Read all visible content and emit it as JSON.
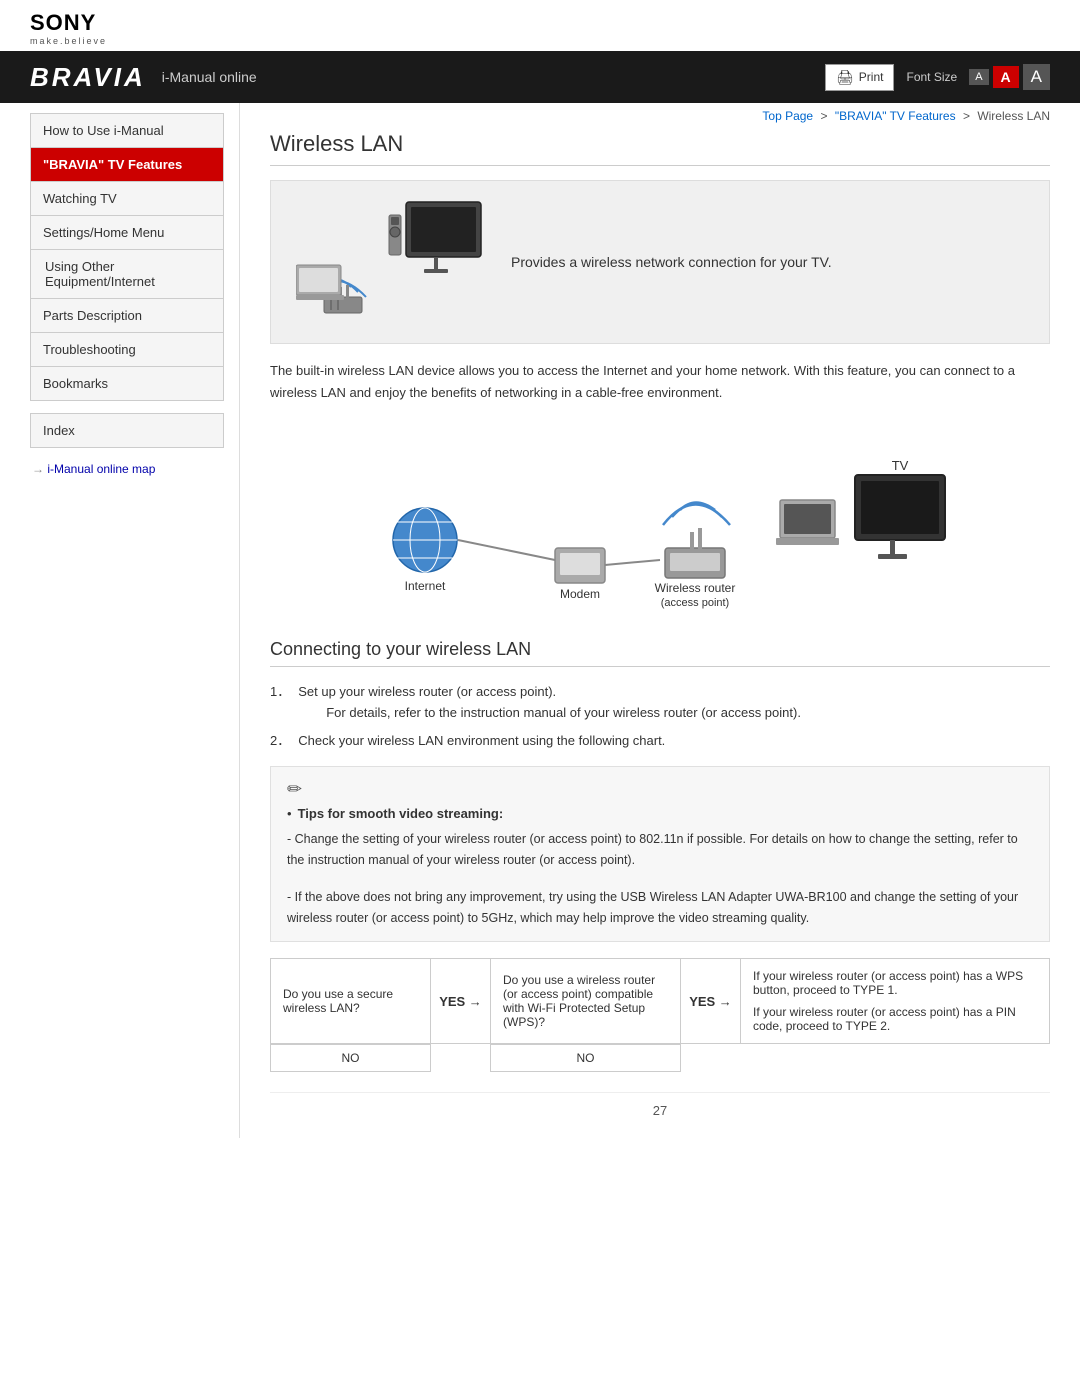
{
  "brand": {
    "name": "SONY",
    "tagline": "make.believe",
    "product": "BRAVIA",
    "subtitle": "i-Manual online"
  },
  "toolbar": {
    "print_label": "Print",
    "font_size_label": "Font Size",
    "font_sizes": [
      "A",
      "A",
      "A"
    ]
  },
  "breadcrumb": {
    "top_page": "Top Page",
    "separator1": ">",
    "section": "\"BRAVIA\" TV Features",
    "separator2": ">",
    "current": "Wireless LAN"
  },
  "sidebar": {
    "items": [
      {
        "id": "how-to-use",
        "label": "How to Use i-Manual",
        "active": false
      },
      {
        "id": "bravia-tv-features",
        "label": "\"BRAVIA\" TV Features",
        "active": true
      },
      {
        "id": "watching-tv",
        "label": "Watching TV",
        "active": false
      },
      {
        "id": "settings-home-menu",
        "label": "Settings/Home Menu",
        "active": false
      },
      {
        "id": "using-other-equipment",
        "label": "Using Other Equipment/Internet",
        "active": false
      },
      {
        "id": "parts-description",
        "label": "Parts Description",
        "active": false
      },
      {
        "id": "troubleshooting",
        "label": "Troubleshooting",
        "active": false
      },
      {
        "id": "bookmarks",
        "label": "Bookmarks",
        "active": false
      }
    ],
    "index_label": "Index",
    "map_link": "i-Manual online map"
  },
  "page": {
    "title": "Wireless LAN",
    "intro_diagram_desc": "Provides a wireless network connection for your TV.",
    "body_text": "The built-in wireless LAN device allows you to access the Internet and your home network. With this feature, you can connect to a wireless LAN and enjoy the benefits of networking in a cable-free environment.",
    "network_labels": {
      "tv": "TV",
      "internet": "Internet",
      "modem": "Modem",
      "wireless_router": "Wireless router",
      "access_point": "(access point)"
    },
    "sub_heading": "Connecting to your wireless LAN",
    "steps": [
      {
        "num": "1",
        "text": "Set up your wireless router (or access point).",
        "sub": "For details, refer to the instruction manual of your wireless router (or access point)."
      },
      {
        "num": "2",
        "text": "Check your wireless LAN environment using the following chart.",
        "sub": ""
      }
    ],
    "note": {
      "bullets": [
        {
          "label": "Tips for smooth video streaming:",
          "items": [
            "- Change the setting of your wireless router (or access point) to 802.11n if possible. For details on how to change the setting, refer to the instruction manual of your wireless router (or access point).",
            "- If the above does not bring any improvement, try using the USB Wireless LAN Adapter UWA-BR100 and change the setting of your wireless router (or access point) to 5GHz, which may help improve the video streaming quality."
          ]
        }
      ]
    },
    "decision_chart": {
      "col1_q": "Do you use a secure wireless LAN?",
      "col1_yes": "YES →",
      "col2_q": "Do you use a wireless router (or access point) compatible with Wi-Fi Protected Setup (WPS)?",
      "col2_yes": "YES →",
      "col3_result1": "If your wireless router (or access point) has a WPS button, proceed to TYPE 1.",
      "col3_result2": "If your wireless router (or access point) has a PIN code, proceed to TYPE 2.",
      "col1_no": "NO",
      "col2_no": "NO"
    },
    "page_number": "27"
  }
}
